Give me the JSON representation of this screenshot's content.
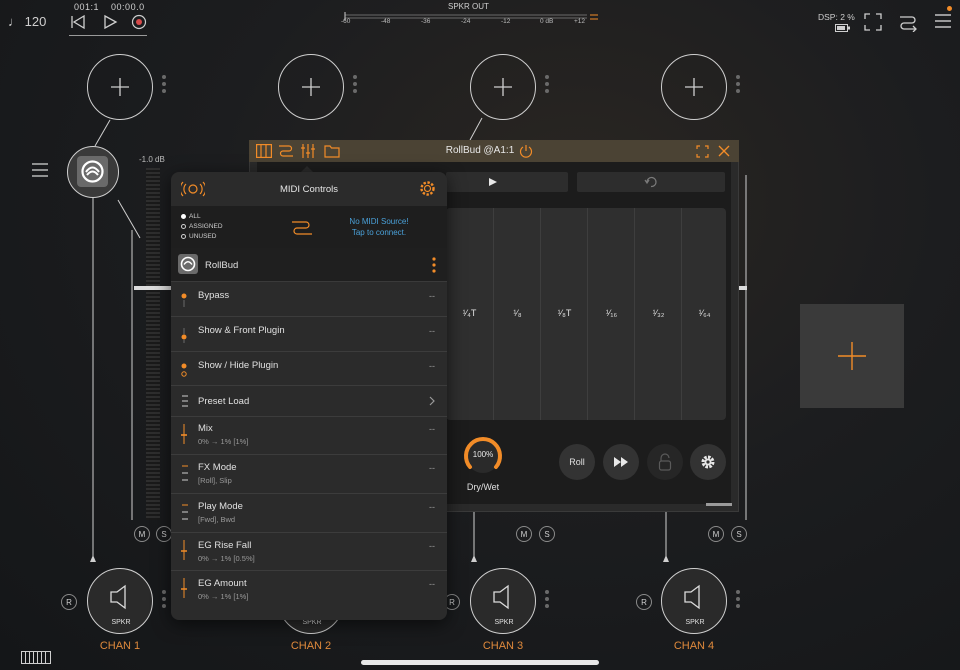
{
  "top_bar": {
    "tempo": "♩ 120",
    "position": "001:1",
    "time": "00:00.0",
    "output_label": "SPKR OUT",
    "meter_scale": [
      "-60",
      "-48",
      "-36",
      "-24",
      "-12",
      "0 dB",
      "+12"
    ],
    "dsp_label": "DSP:  2 %"
  },
  "channels": [
    {
      "name": "CHAN 1",
      "output": "SPKR"
    },
    {
      "name": "CHAN 2",
      "output": "SPKR"
    },
    {
      "name": "CHAN 3",
      "output": "SPKR"
    },
    {
      "name": "CHAN 4",
      "output": "SPKR"
    }
  ],
  "fader": {
    "db_label": "-1.0 dB"
  },
  "mute_label": "M",
  "solo_label": "S",
  "record_label": "R",
  "plugin_window": {
    "title": "RollBud @A1:1",
    "divisions": [
      "¹⁄₄T",
      "¹⁄₈",
      "¹⁄₈T",
      "¹⁄₁₆",
      "¹⁄₃₂",
      "¹⁄₆₄"
    ],
    "knob_value": "100%",
    "knob_label": "Dry/Wet",
    "roll_label": "Roll"
  },
  "midi_controls": {
    "title": "MIDI Controls",
    "filters": [
      "ALL",
      "ASSIGNED",
      "UNUSED"
    ],
    "selected_filter": "ALL",
    "source_line1": "No MIDI Source!",
    "source_line2": "Tap to connect.",
    "plugin_name": "RollBud",
    "controls": [
      {
        "name": "Bypass",
        "sub": "",
        "value": "--"
      },
      {
        "name": "Show & Front Plugin",
        "sub": "",
        "value": "--"
      },
      {
        "name": "Show / Hide Plugin",
        "sub": "",
        "value": "--"
      },
      {
        "name": "Preset Load",
        "sub": "",
        "value": ""
      },
      {
        "name": "Mix",
        "sub": "0% → 1%  [1%]",
        "value": "--"
      },
      {
        "name": "FX Mode",
        "sub": "[Roll], Slip",
        "value": "--"
      },
      {
        "name": "Play Mode",
        "sub": "[Fwd], Bwd",
        "value": "--"
      },
      {
        "name": "EG Rise Fall",
        "sub": "0% → 1%  [0.5%]",
        "value": "--"
      },
      {
        "name": "EG Amount",
        "sub": "0% → 1%  [1%]",
        "value": "--"
      }
    ]
  },
  "colors": {
    "accent": "#f28c28",
    "link": "#4aa0d8",
    "title_bar": "#4b4334"
  }
}
